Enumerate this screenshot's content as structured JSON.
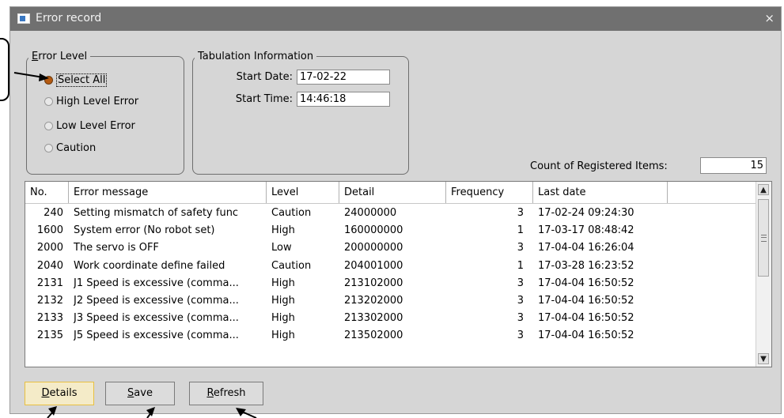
{
  "window": {
    "title": "Error record",
    "close_glyph": "×"
  },
  "error_level": {
    "legend": "Error Level",
    "options": [
      {
        "label": "Select All",
        "checked": true
      },
      {
        "label": "High Level Error",
        "checked": false
      },
      {
        "label": "Low Level Error",
        "checked": false
      },
      {
        "label": "Caution",
        "checked": false
      }
    ]
  },
  "tabulation": {
    "legend": "Tabulation Information",
    "start_date_label": "Start Date:",
    "start_date": "17-02-22",
    "start_time_label": "Start Time:",
    "start_time": "14:46:18"
  },
  "count": {
    "label": "Count of Registered Items:",
    "value": "15"
  },
  "table": {
    "columns": [
      "No.",
      "Error message",
      "Level",
      "Detail",
      "Frequency",
      "Last date"
    ],
    "rows": [
      {
        "no": "240",
        "message": "Setting mismatch of safety func",
        "level": "Caution",
        "detail": "24000000",
        "frequency": "3",
        "last_date": "17-02-24 09:24:30"
      },
      {
        "no": "1600",
        "message": "System error (No robot set)",
        "level": "High",
        "detail": "160000000",
        "frequency": "1",
        "last_date": "17-03-17 08:48:42"
      },
      {
        "no": "2000",
        "message": "The servo is OFF",
        "level": "Low",
        "detail": "200000000",
        "frequency": "3",
        "last_date": "17-04-04 16:26:04"
      },
      {
        "no": "2040",
        "message": "Work coordinate define failed",
        "level": "Caution",
        "detail": "204001000",
        "frequency": "1",
        "last_date": "17-03-28 16:23:52"
      },
      {
        "no": "2131",
        "message": "J1 Speed is excessive (comma...",
        "level": "High",
        "detail": "213102000",
        "frequency": "3",
        "last_date": "17-04-04 16:50:52"
      },
      {
        "no": "2132",
        "message": "J2 Speed is excessive (comma...",
        "level": "High",
        "detail": "213202000",
        "frequency": "3",
        "last_date": "17-04-04 16:50:52"
      },
      {
        "no": "2133",
        "message": "J3 Speed is excessive (comma...",
        "level": "High",
        "detail": "213302000",
        "frequency": "3",
        "last_date": "17-04-04 16:50:52"
      },
      {
        "no": "2135",
        "message": "J5 Speed is excessive (comma...",
        "level": "High",
        "detail": "213502000",
        "frequency": "3",
        "last_date": "17-04-04 16:50:52"
      }
    ]
  },
  "buttons": {
    "details": {
      "mnemonic": "D",
      "rest": "etails"
    },
    "save": {
      "mnemonic": "S",
      "rest": "ave"
    },
    "refresh": {
      "mnemonic": "R",
      "rest": "efresh"
    }
  },
  "scrollbar": {
    "up_glyph": "▲",
    "down_glyph": "▼"
  },
  "icons": [
    "app-window-icon",
    "close-icon",
    "grip-icon",
    "callout-arrow-icon"
  ]
}
